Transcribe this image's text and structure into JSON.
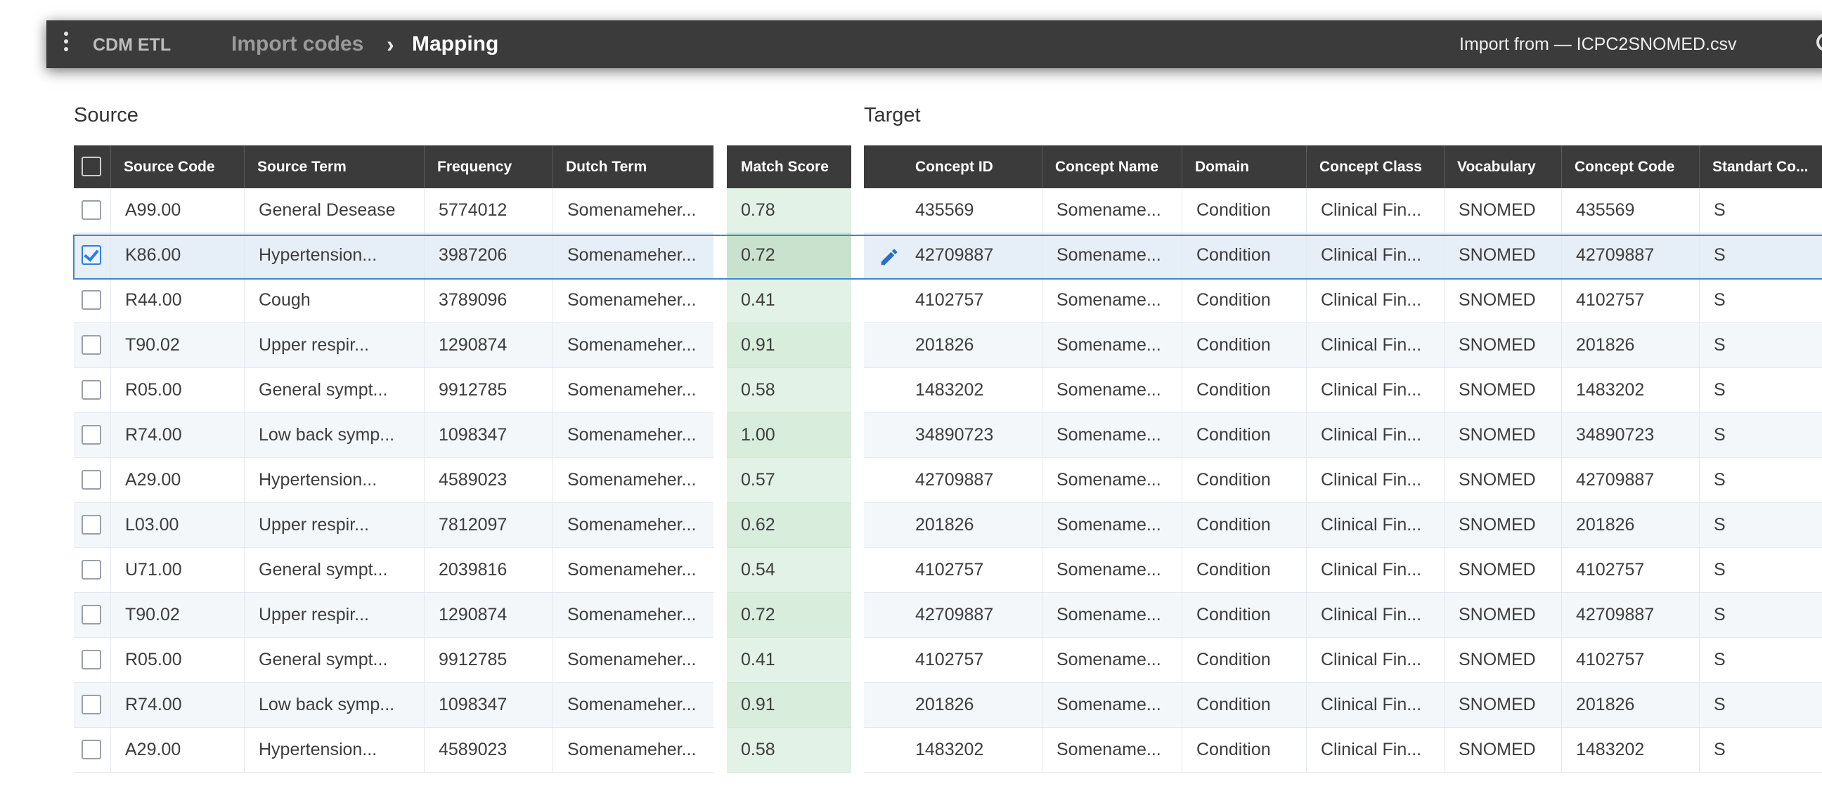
{
  "topbar": {
    "app_name": "CDM ETL",
    "breadcrumb_link": "Import codes",
    "breadcrumb_separator": "›",
    "breadcrumb_current": "Mapping",
    "import_from": "Import from — ICPC2SNOMED.csv"
  },
  "source": {
    "title": "Source",
    "columns": [
      "Source Code",
      "Source Term",
      "Frequency",
      "Dutch Term"
    ],
    "rows": [
      {
        "code": "A99.00",
        "term": "General Desease",
        "freq": "5774012",
        "dutch": "Somenameher...",
        "checked": false
      },
      {
        "code": "K86.00",
        "term": "Hypertension...",
        "freq": "3987206",
        "dutch": "Somenameher...",
        "checked": true
      },
      {
        "code": "R44.00",
        "term": "Cough",
        "freq": "3789096",
        "dutch": "Somenameher...",
        "checked": false
      },
      {
        "code": "T90.02",
        "term": "Upper respir...",
        "freq": "1290874",
        "dutch": "Somenameher...",
        "checked": false
      },
      {
        "code": "R05.00",
        "term": "General sympt...",
        "freq": "9912785",
        "dutch": "Somenameher...",
        "checked": false
      },
      {
        "code": "R74.00",
        "term": "Low back symp...",
        "freq": "1098347",
        "dutch": "Somenameher...",
        "checked": false
      },
      {
        "code": "A29.00",
        "term": "Hypertension...",
        "freq": "4589023",
        "dutch": "Somenameher...",
        "checked": false
      },
      {
        "code": "L03.00",
        "term": "Upper respir...",
        "freq": "7812097",
        "dutch": "Somenameher...",
        "checked": false
      },
      {
        "code": "U71.00",
        "term": "General sympt...",
        "freq": "2039816",
        "dutch": "Somenameher...",
        "checked": false
      },
      {
        "code": "T90.02",
        "term": "Upper respir...",
        "freq": "1290874",
        "dutch": "Somenameher...",
        "checked": false
      },
      {
        "code": "R05.00",
        "term": "General sympt...",
        "freq": "9912785",
        "dutch": "Somenameher...",
        "checked": false
      },
      {
        "code": "R74.00",
        "term": "Low back symp...",
        "freq": "1098347",
        "dutch": "Somenameher...",
        "checked": false
      },
      {
        "code": "A29.00",
        "term": "Hypertension...",
        "freq": "4589023",
        "dutch": "Somenameher...",
        "checked": false
      }
    ]
  },
  "match": {
    "header": "Match Score",
    "scores": [
      "0.78",
      "0.72",
      "0.41",
      "0.91",
      "0.58",
      "1.00",
      "0.57",
      "0.62",
      "0.54",
      "0.72",
      "0.41",
      "0.91",
      "0.58"
    ]
  },
  "target": {
    "title": "Target",
    "columns": [
      "Concept ID",
      "Concept Name",
      "Domain",
      "Concept Class",
      "Vocabulary",
      "Concept Code",
      "Standart Co..."
    ],
    "rows": [
      {
        "id": "435569",
        "name": "Somename...",
        "domain": "Condition",
        "cls": "Clinical Fin...",
        "vocab": "SNOMED",
        "code": "435569",
        "std": "S"
      },
      {
        "id": "42709887",
        "name": "Somename...",
        "domain": "Condition",
        "cls": "Clinical Fin...",
        "vocab": "SNOMED",
        "code": "42709887",
        "std": "S"
      },
      {
        "id": "4102757",
        "name": "Somename...",
        "domain": "Condition",
        "cls": "Clinical Fin...",
        "vocab": "SNOMED",
        "code": "4102757",
        "std": "S"
      },
      {
        "id": "201826",
        "name": "Somename...",
        "domain": "Condition",
        "cls": "Clinical Fin...",
        "vocab": "SNOMED",
        "code": "201826",
        "std": "S"
      },
      {
        "id": "1483202",
        "name": "Somename...",
        "domain": "Condition",
        "cls": "Clinical Fin...",
        "vocab": "SNOMED",
        "code": "1483202",
        "std": "S"
      },
      {
        "id": "34890723",
        "name": "Somename...",
        "domain": "Condition",
        "cls": "Clinical Fin...",
        "vocab": "SNOMED",
        "code": "34890723",
        "std": "S"
      },
      {
        "id": "42709887",
        "name": "Somename...",
        "domain": "Condition",
        "cls": "Clinical Fin...",
        "vocab": "SNOMED",
        "code": "42709887",
        "std": "S"
      },
      {
        "id": "201826",
        "name": "Somename...",
        "domain": "Condition",
        "cls": "Clinical Fin...",
        "vocab": "SNOMED",
        "code": "201826",
        "std": "S"
      },
      {
        "id": "4102757",
        "name": "Somename...",
        "domain": "Condition",
        "cls": "Clinical Fin...",
        "vocab": "SNOMED",
        "code": "4102757",
        "std": "S"
      },
      {
        "id": "42709887",
        "name": "Somename...",
        "domain": "Condition",
        "cls": "Clinical Fin...",
        "vocab": "SNOMED",
        "code": "42709887",
        "std": "S"
      },
      {
        "id": "4102757",
        "name": "Somename...",
        "domain": "Condition",
        "cls": "Clinical Fin...",
        "vocab": "SNOMED",
        "code": "4102757",
        "std": "S"
      },
      {
        "id": "201826",
        "name": "Somename...",
        "domain": "Condition",
        "cls": "Clinical Fin...",
        "vocab": "SNOMED",
        "code": "201826",
        "std": "S"
      },
      {
        "id": "1483202",
        "name": "Somename...",
        "domain": "Condition",
        "cls": "Clinical Fin...",
        "vocab": "SNOMED",
        "code": "1483202",
        "std": "S"
      }
    ]
  },
  "icons": {
    "menu": "kebab-menu-icon",
    "edit": "pencil-icon",
    "check": "checkbox-icon"
  },
  "colors": {
    "header_bg": "#3b3b3b",
    "accent": "#2f7ed8",
    "score_bg": "#e3f2e6",
    "alt_row": "#f3f7fa"
  }
}
